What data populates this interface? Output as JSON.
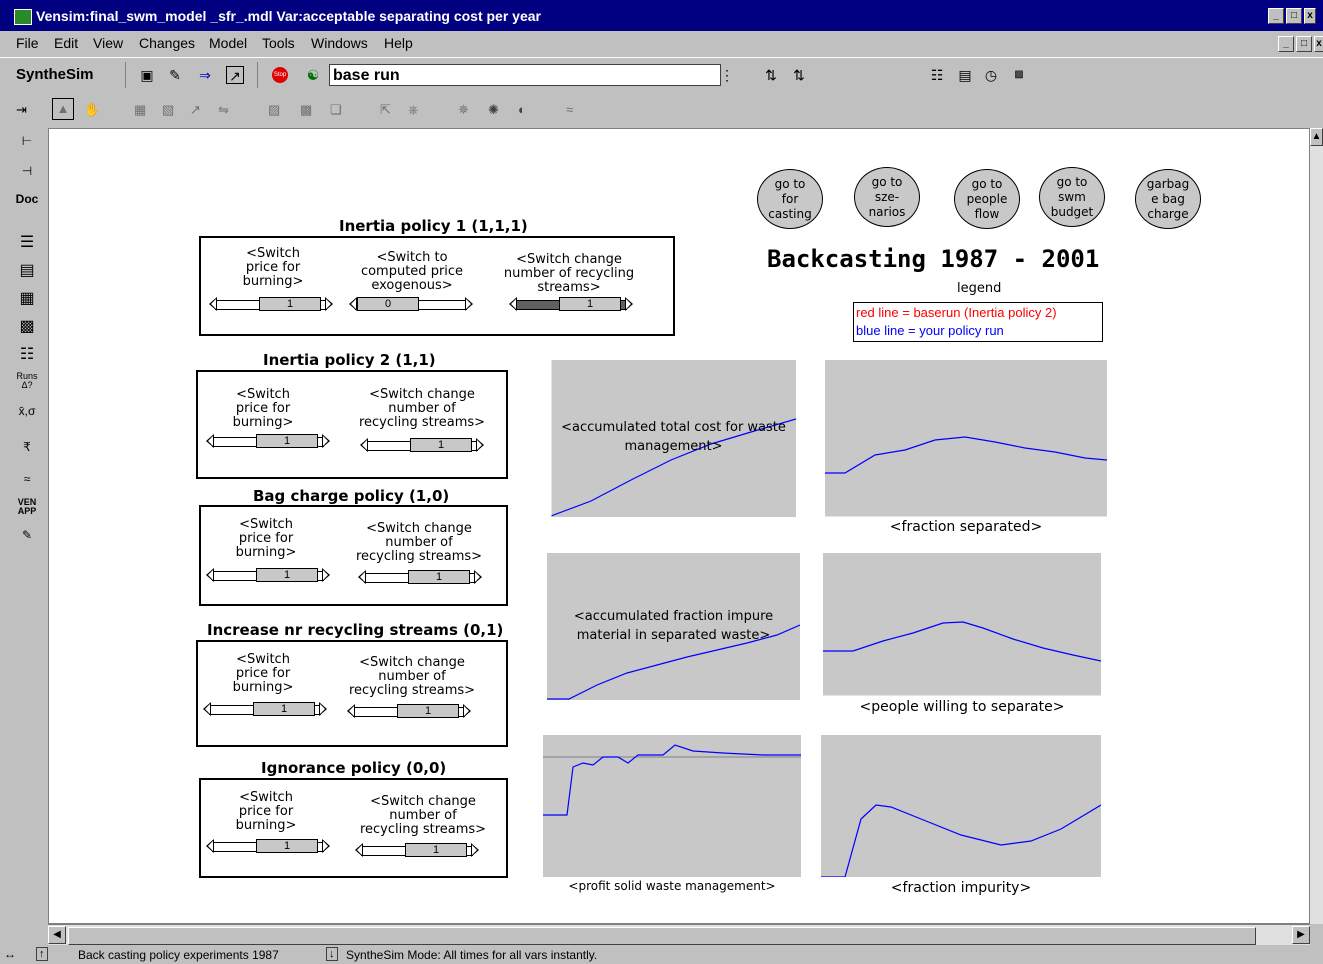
{
  "window": {
    "title": "Vensim:final_swm_model _sfr_.mdl Var:acceptable separating cost per year",
    "controls": [
      "_",
      "□",
      "x"
    ],
    "inner_controls": [
      "_",
      "□",
      "x"
    ]
  },
  "menu": [
    "File",
    "Edit",
    "View",
    "Changes",
    "Model",
    "Tools",
    "Windows",
    "Help"
  ],
  "toolbar": {
    "label": "SyntheSim",
    "run_name": "base run",
    "stop_label": "Stop"
  },
  "left_tools": [
    "Doc",
    "Runs Δ?",
    "x̄,σ",
    "VEN APP"
  ],
  "canvas": {
    "title": "Backcasting 1987 - 2001",
    "legend_label": "legend",
    "legend_red": "red line = baserun (Inertia policy 2)",
    "legend_blue": "blue line = your policy run",
    "nav_buttons": [
      "go to\nfor\ncasting",
      "go to\nsze-\nnarios",
      "go to\npeople\nflow",
      "go to\nswm\nbudget",
      "garbag\ne bag\ncharge"
    ],
    "policies": [
      {
        "title": "Inertia policy 1  (1,1,1)",
        "switches": [
          {
            "label": "<Switch\nprice for\nburning>",
            "value": "1"
          },
          {
            "label": "<Switch to\ncomputed price\nexogenous>",
            "value": "0"
          },
          {
            "label": "<Switch change\nnumber of recycling\nstreams>",
            "value": "1"
          }
        ]
      },
      {
        "title": "Inertia policy 2  (1,1)",
        "switches": [
          {
            "label": "<Switch\nprice for\nburning>",
            "value": "1"
          },
          {
            "label": "<Switch change\nnumber of\nrecycling streams>",
            "value": "1"
          }
        ]
      },
      {
        "title": "Bag charge policy   (1,0)",
        "switches": [
          {
            "label": "<Switch\nprice for\nburning>",
            "value": "1"
          },
          {
            "label": "<Switch change\nnumber of\nrecycling streams>",
            "value": "1"
          }
        ]
      },
      {
        "title": "Increase nr recycling streams  (0,1)",
        "switches": [
          {
            "label": "<Switch\nprice for\nburning>",
            "value": "1"
          },
          {
            "label": "<Switch change\nnumber of\nrecycling streams>",
            "value": "1"
          }
        ]
      },
      {
        "title": "Ignorance policy  (0,0)",
        "switches": [
          {
            "label": "<Switch\nprice for\nburning>",
            "value": "1"
          },
          {
            "label": "<Switch change\nnumber of\nrecycling streams>",
            "value": "1"
          }
        ]
      }
    ],
    "graphs": [
      {
        "label": "<accumulated total cost for waste\nmanagement>",
        "position": "inside"
      },
      {
        "label": "<fraction separated>",
        "position": "below"
      },
      {
        "label": "<accumulated fraction impure\nmaterial in separated waste>",
        "position": "inside"
      },
      {
        "label": "<people willing to separate>",
        "position": "below"
      },
      {
        "label": "<profit solid waste management>",
        "position": "below"
      },
      {
        "label": "<fraction impurity>",
        "position": "below"
      }
    ]
  },
  "colors": {
    "baserun": "#ff0000",
    "policy_run": "#0000ff",
    "title_bar": "#000080"
  },
  "status": {
    "view_name": "Back casting policy experiments 1987",
    "mode": "SyntheSim Mode: All times for all vars instantly."
  }
}
